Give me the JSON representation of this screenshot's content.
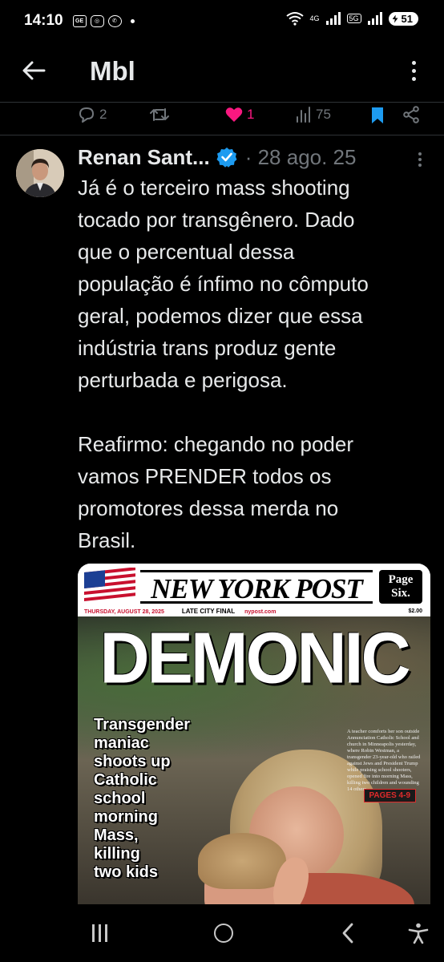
{
  "status_bar": {
    "time": "14:10",
    "left_icons": [
      "ge-icon",
      "instagram-icon",
      "whatsapp-icon"
    ],
    "wifi_label": "4G",
    "network_label": "5G",
    "battery": "51"
  },
  "top_nav": {
    "title": "Mbl",
    "back_icon": "arrow-left-icon",
    "more_icon": "more-vertical-icon"
  },
  "actions": {
    "reply_count": "2",
    "retweet_count": "",
    "like_count": "1",
    "views_count": "75"
  },
  "tweet": {
    "author_name": "Renan Sant...",
    "date": "· 28 ago. 25",
    "paragraph_1": "Já é o terceiro mass shooting\ntocado por transgênero. Dado\nque o percentual dessa\npopulação é ínfimo no cômputo\ngeral, podemos dizer que essa\nindústria trans produz gente\nperturbada e perigosa.",
    "paragraph_2": "Reafirmo: chegando no poder\nvamos PRENDER todos os\npromotores dessa merda no\nBrasil."
  },
  "media": {
    "paper_name": "NEW YORK POST",
    "page_six": "Page\nSix.",
    "dateline": "THURSDAY, AUGUST 28, 2025",
    "edition": "LATE CITY FINAL",
    "website": "nypost.com",
    "price": "$2.00",
    "main_headline": "DEMONIC",
    "sub_headline": "Transgender\nmaniac\nshoots up\nCatholic\nschool\nmorning\nMass,\nkilling\ntwo kids",
    "caption": "A teacher comforts her son outside Annunciation Catholic School and church in Minneapolis yesterday, where Robin Westman, a transgender 23-year-old who railed against Jews and President Trump while praising school shooters, opened fire into morning Mass, killing two children and wounding 14 others.",
    "pages_tag": "PAGES 4-9"
  },
  "colors": {
    "background": "#000000",
    "text": "#e7e9ea",
    "muted": "#71767b",
    "like": "#f91880",
    "bookmark": "#1d9bf0",
    "verified": "#1d9bf0",
    "divider": "#2f3336"
  }
}
